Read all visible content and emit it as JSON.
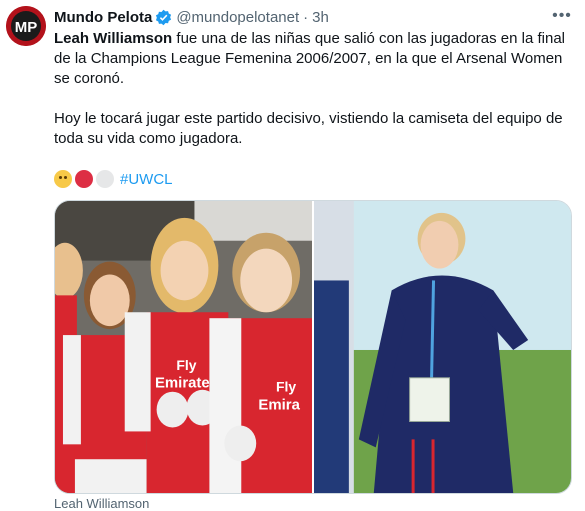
{
  "author": {
    "name": "Mundo Pelota",
    "handle": "@mundopelotanet",
    "separator": "·",
    "time": "3h",
    "verified": true,
    "avatar_icon": "mundo-pelota-logo-icon"
  },
  "more_icon": "ellipsis-icon",
  "tweet": {
    "bold_name": "Leah Williamson",
    "line1_rest": " fue una de las niñas que salió con las jugadoras en la final de la Champions League Femenina 2006/2007, en la que el Arsenal Women se coronó.",
    "line2": "Hoy le tocará jugar este partido decisivo, vistiendo la camiseta del equipo de toda su vida como jugadora.",
    "emojis": [
      "crying-face-emoji",
      "red-circle-emoji",
      "white-circle-emoji"
    ],
    "hashtag": "#UWCL"
  },
  "media": {
    "left_photo": {
      "icon": "young-girls-arsenal-kit-photo",
      "shirt_text": "Fly Emirates"
    },
    "right_photo": {
      "icon": "adult-player-arsenal-tracksuit-photo"
    }
  },
  "caption": "Leah Williamson",
  "colors": {
    "link": "#1d9bf0",
    "secondary_text": "#536471",
    "arsenal_red": "#d8262f",
    "border": "#cfd9de"
  }
}
